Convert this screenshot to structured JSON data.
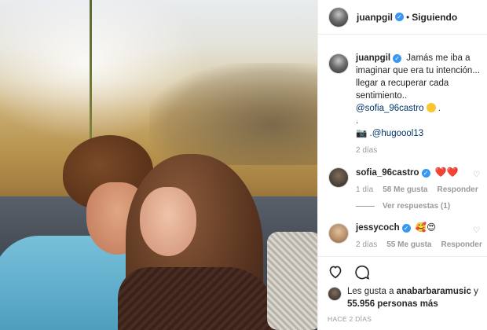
{
  "post": {
    "owner": "juanpgil",
    "follow_status": "Siguiendo",
    "separator": "•",
    "caption_text": "Jamás me iba a imaginar que era tu intención... llegar a recuperar cada sentimiento..",
    "caption_mention": "@sofia_96castro",
    "caption_suffix": ".",
    "caption_dot": ".",
    "caption_camera": "📷",
    "caption_photo_credit": ".@hugoool13",
    "caption_age": "2 días"
  },
  "comments": [
    {
      "username": "sofia_96castro",
      "text": "❤️❤️",
      "age": "1 día",
      "likes": "58 Me gusta",
      "reply_label": "Responder",
      "view_replies": "Ver respuestas (1)"
    },
    {
      "username": "jessycoch",
      "text": "🥰😍",
      "age": "2 días",
      "likes": "55 Me gusta",
      "reply_label": "Responder"
    }
  ],
  "likes_summary": {
    "prefix": "Les gusta a ",
    "user": "anabarbaramusic",
    "joiner": " y",
    "count": "55.956 personas más"
  },
  "posted_ago": "HACE 2 DÍAS",
  "colors": {
    "verified": "#3897f0",
    "link": "#003569",
    "muted": "#999999"
  },
  "icons": [
    "heart-icon",
    "comment-icon",
    "verified-badge-icon"
  ]
}
